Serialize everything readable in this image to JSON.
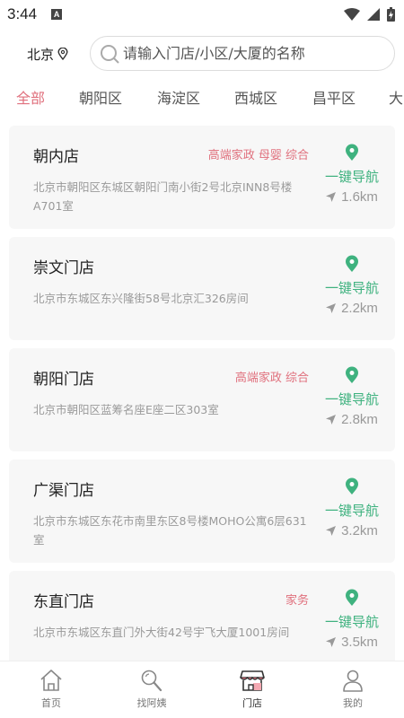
{
  "status_bar": {
    "time": "3:44",
    "notification_badge": "A"
  },
  "header": {
    "city": "北京",
    "search_placeholder": "请输入门店/小区/大厦的名称"
  },
  "districts": [
    "全部",
    "朝阳区",
    "海淀区",
    "西城区",
    "昌平区",
    "大"
  ],
  "active_district": "全部",
  "stores": [
    {
      "name": "朝内店",
      "tags": "高端家政 母婴 综合",
      "address": "北京市朝阳区东城区朝阳门南小街2号北京INN8号楼A701室",
      "nav_label": "一键导航",
      "distance": "1.6km"
    },
    {
      "name": "崇文门店",
      "tags": "",
      "address": "北京市东城区东兴隆街58号北京汇326房间",
      "nav_label": "一键导航",
      "distance": "2.2km"
    },
    {
      "name": "朝阳门店",
      "tags": "高端家政 综合",
      "address": "北京市朝阳区蓝筹名座E座二区303室",
      "nav_label": "一键导航",
      "distance": "2.8km"
    },
    {
      "name": "广渠门店",
      "tags": "",
      "address": "北京市东城区东花市南里东区8号楼MOHO公寓6层631室",
      "nav_label": "一键导航",
      "distance": "3.2km"
    },
    {
      "name": "东直门店",
      "tags": "家务",
      "address": "北京市东城区东直门外大街42号宇飞大厦1001房间",
      "nav_label": "一键导航",
      "distance": "3.5km"
    }
  ],
  "bottom_nav": [
    {
      "label": "首页",
      "icon": "home-icon"
    },
    {
      "label": "找阿姨",
      "icon": "magnifier-icon"
    },
    {
      "label": "门店",
      "icon": "store-icon"
    },
    {
      "label": "我的",
      "icon": "user-icon"
    }
  ],
  "active_nav": "门店",
  "colors": {
    "accent_pink": "#e0707d",
    "accent_green": "#3fb27f",
    "card_bg": "#f7f7f7"
  }
}
